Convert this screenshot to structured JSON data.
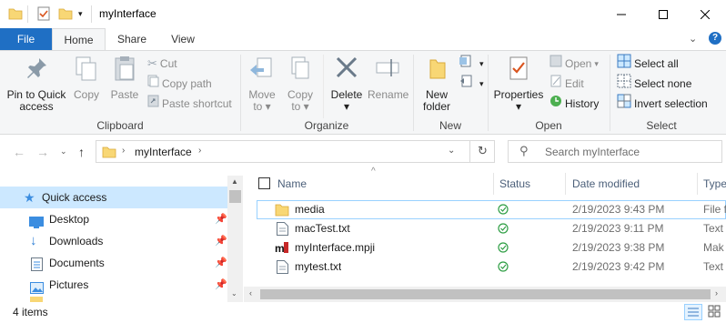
{
  "window": {
    "title": "myInterface",
    "controls": {
      "minimize": "minimize-icon",
      "maximize": "maximize-icon",
      "close": "close-icon"
    }
  },
  "ribbon_tabs": [
    {
      "label": "File"
    },
    {
      "label": "Home"
    },
    {
      "label": "Share"
    },
    {
      "label": "View"
    }
  ],
  "ribbon": {
    "clipboard": {
      "group_label": "Clipboard",
      "pin_to_quick_access": [
        "Pin to Quick",
        "access"
      ],
      "copy": "Copy",
      "paste": "Paste",
      "cut": "Cut",
      "copy_path": "Copy path",
      "paste_shortcut": "Paste shortcut"
    },
    "organize": {
      "group_label": "Organize",
      "move_to": [
        "Move",
        "to"
      ],
      "copy_to": [
        "Copy",
        "to"
      ],
      "delete": "Delete",
      "rename": "Rename"
    },
    "new": {
      "group_label": "New",
      "new_folder": [
        "New",
        "folder"
      ]
    },
    "open": {
      "group_label": "Open",
      "properties": "Properties",
      "open": "Open",
      "edit": "Edit",
      "history": "History"
    },
    "select": {
      "group_label": "Select",
      "select_all": "Select all",
      "select_none": "Select none",
      "invert_selection": "Invert selection"
    }
  },
  "address": {
    "path_segment": "myInterface",
    "search_placeholder": "Search myInterface"
  },
  "nav_pane": {
    "items": [
      {
        "label": "Quick access",
        "icon": "star-icon",
        "selected": true
      },
      {
        "label": "Desktop",
        "icon": "desktop-icon",
        "pinned": true
      },
      {
        "label": "Downloads",
        "icon": "download-icon",
        "pinned": true
      },
      {
        "label": "Documents",
        "icon": "documents-icon",
        "pinned": true
      },
      {
        "label": "Pictures",
        "icon": "pictures-icon",
        "pinned": true
      }
    ]
  },
  "file_list": {
    "columns": [
      "Name",
      "Status",
      "Date modified",
      "Type"
    ],
    "rows": [
      {
        "name": "media",
        "icon": "folder-icon",
        "status": "synced",
        "date": "2/19/2023 9:43 PM",
        "type": "File f"
      },
      {
        "name": "macTest.txt",
        "icon": "text-file-icon",
        "status": "synced",
        "date": "2/19/2023 9:11 PM",
        "type": "Text"
      },
      {
        "name": "myInterface.mpji",
        "icon": "mpji-file-icon",
        "status": "synced",
        "date": "2/19/2023 9:38 PM",
        "type": "Mak"
      },
      {
        "name": "mytest.txt",
        "icon": "text-file-icon",
        "status": "synced",
        "date": "2/19/2023 9:42 PM",
        "type": "Text"
      }
    ]
  },
  "status_bar": {
    "item_count": "4 items"
  },
  "colors": {
    "file_tab": "#1f6fc4",
    "selection": "#cce8ff",
    "status_ok": "#2e9e44",
    "folder": "#f8d775"
  }
}
